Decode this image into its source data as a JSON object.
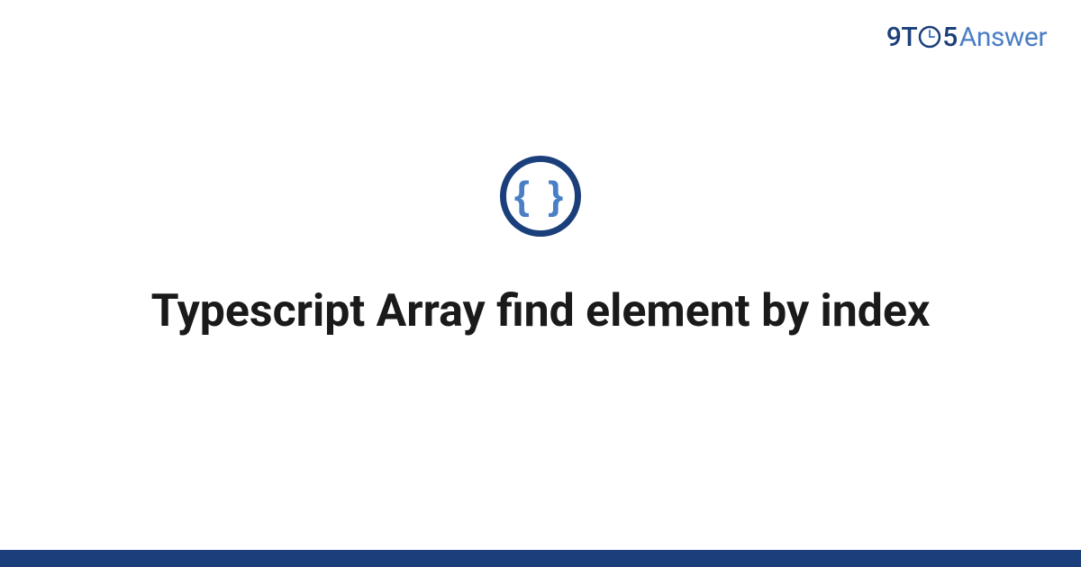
{
  "header": {
    "logo_part1": "9T",
    "logo_part2": "5",
    "logo_part3": "Answer"
  },
  "main": {
    "icon_glyph": "{ }",
    "title": "Typescript Array find element by index"
  }
}
